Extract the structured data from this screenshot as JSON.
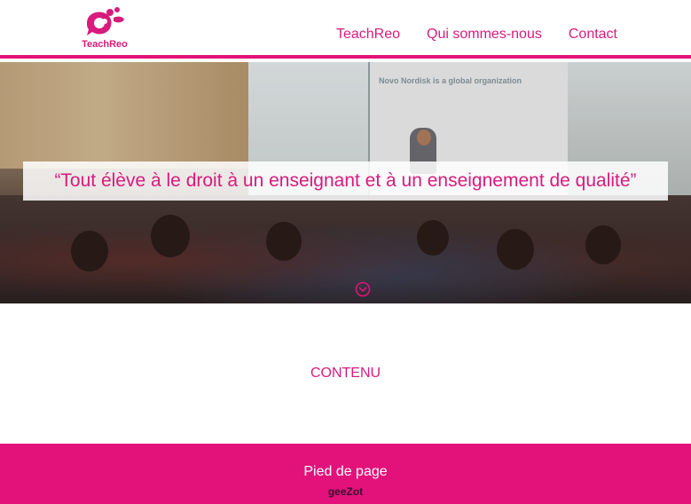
{
  "header": {
    "logo_text": "TeachReo",
    "nav": [
      {
        "label": "TeachReo"
      },
      {
        "label": "Qui sommes-nous"
      },
      {
        "label": "Contact"
      }
    ]
  },
  "hero": {
    "quote": "“Tout élève à le droit à un enseignant et à un enseignement de qualité”",
    "screen_text": "Novo Nordisk is a global organization",
    "scroll_icon": "chevron-down-circle-icon"
  },
  "content": {
    "title": "CONTENU"
  },
  "footer": {
    "title": "Pied de page",
    "brand": "geeZot"
  },
  "colors": {
    "accent": "#e2127a",
    "text_accent": "#d81b7d",
    "background": "#ffffff"
  }
}
